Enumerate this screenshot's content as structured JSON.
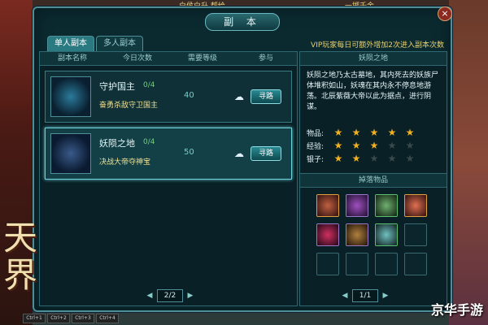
{
  "top": {
    "left_text": "白侯白升 帮给",
    "right_text": "一掷千金"
  },
  "window": {
    "title": "副 本",
    "close_label": "×",
    "tabs": [
      {
        "label": "单人副本"
      },
      {
        "label": "多人副本"
      }
    ],
    "vip_note": "VIP玩家每日可额外增加2次进入副本次数"
  },
  "list": {
    "headers": [
      "副本名称",
      "今日次数",
      "需要等级",
      "参与"
    ],
    "rows": [
      {
        "name": "守护国主",
        "count": "0/4",
        "desc": "奋勇杀敌守卫国主",
        "level": "40",
        "button": "寻路"
      },
      {
        "name": "妖陨之地",
        "count": "0/4",
        "desc": "决战大帝夺神宝",
        "level": "50",
        "button": "寻路"
      }
    ],
    "pager": {
      "text": "2/2",
      "prev": "◀",
      "next": "▶"
    }
  },
  "detail": {
    "title": "妖陨之地",
    "desc": "妖陨之地乃太古墓地，其内死去的妖族尸体堆积如山，妖魂在其内永不停息地游荡。北辰紫薇大帝以此为据点，进行阴谋。",
    "stats": [
      {
        "label": "物品:",
        "rating": 5
      },
      {
        "label": "经验:",
        "rating": 3
      },
      {
        "label": "银子:",
        "rating": 2
      }
    ],
    "star_glyph": "★",
    "drops_title": "掉落物品",
    "pager": {
      "text": "1/1",
      "prev": "◀",
      "next": "▶"
    }
  },
  "logo": {
    "text": "天界"
  },
  "watermark": {
    "text": "京华手游"
  },
  "ctrl_keys": [
    "Ctrl+1",
    "Ctrl+2",
    "Ctrl+3",
    "Ctrl+4"
  ],
  "hotbar": [
    "",
    "",
    "",
    "",
    "",
    "",
    "",
    "",
    ""
  ],
  "colors": {
    "accent": "#4f8e97",
    "star_on": "#f0b020",
    "star_off": "#3a4a4a",
    "highlight": "#f0e090"
  }
}
